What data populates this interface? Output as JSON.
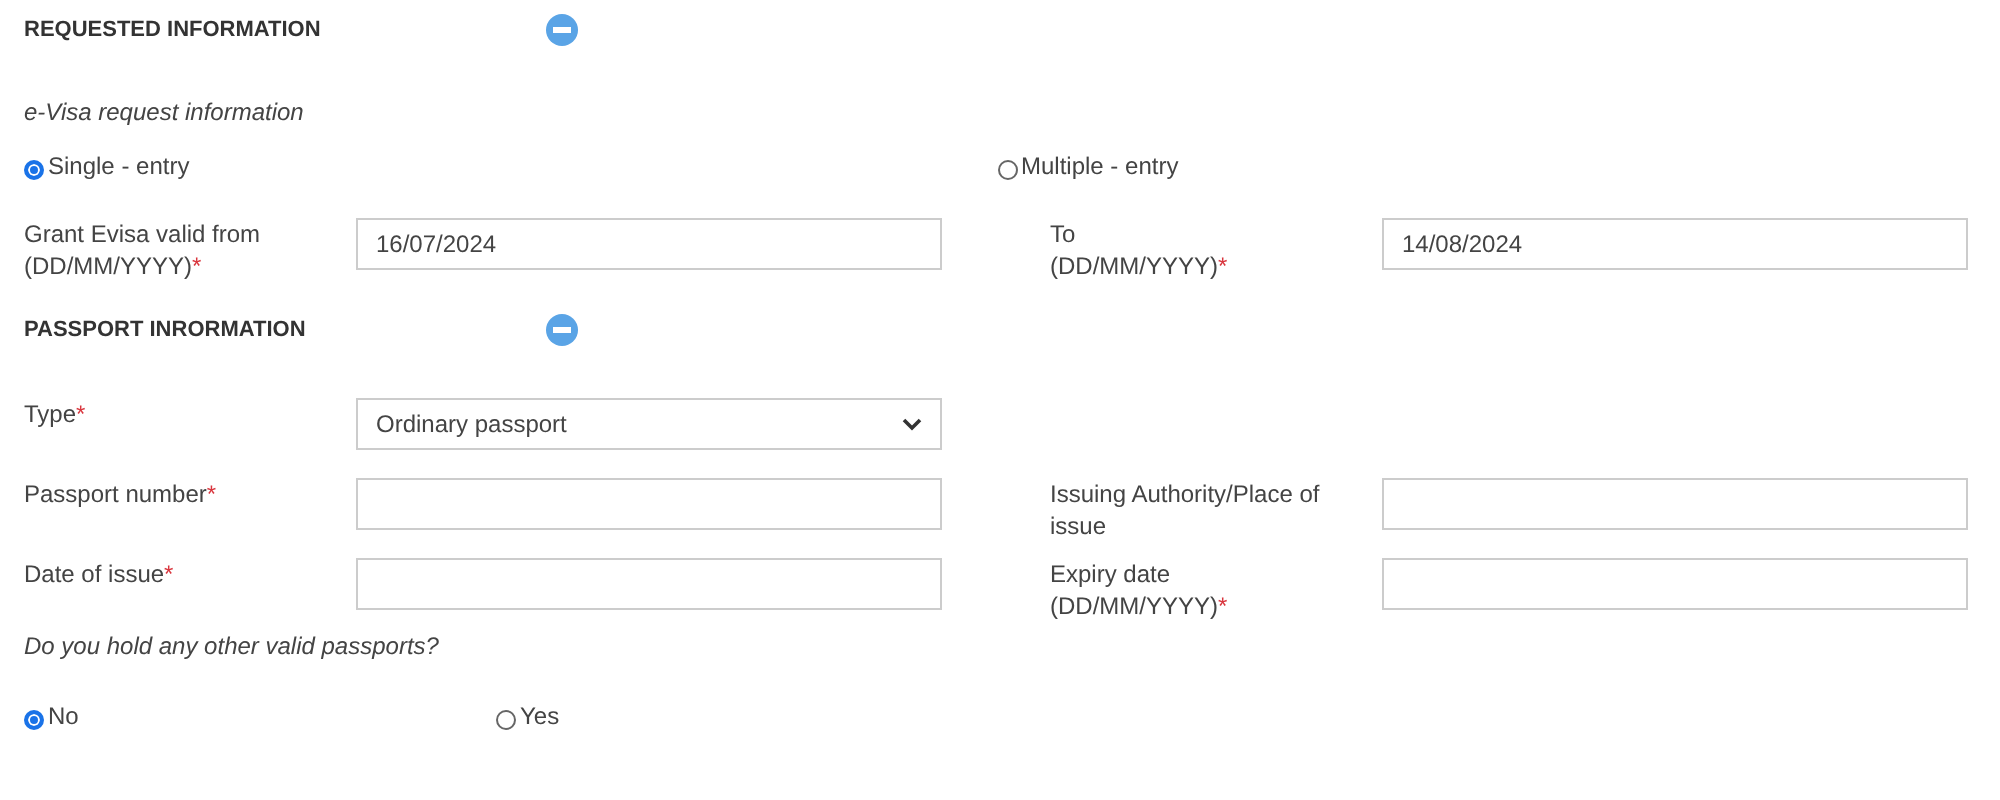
{
  "sections": [
    {
      "heading": "REQUESTED INFORMATION",
      "expanded": true,
      "blocks": [
        {
          "kind": "note",
          "text": "e-Visa request information"
        },
        {
          "kind": "radios",
          "options": [
            {
              "label": "Single - entry",
              "selected": true
            },
            {
              "label": "Multiple - entry",
              "selected": false
            }
          ]
        },
        {
          "kind": "row",
          "fields": [
            {
              "kind": "text",
              "label": "Grant Evisa valid from\n(DD/MM/YYYY)",
              "required_mark": "*",
              "value": "16/07/2024"
            },
            {
              "kind": "text",
              "label": "To\n(DD/MM/YYYY)",
              "required_mark": "*",
              "value": "14/08/2024"
            }
          ]
        }
      ]
    },
    {
      "heading": "PASSPORT INRORMATION",
      "expanded": true,
      "blocks": [
        {
          "kind": "row",
          "fields": [
            {
              "kind": "select",
              "label": "Type",
              "required_mark": "*",
              "value": "Ordinary passport"
            }
          ]
        },
        {
          "kind": "row",
          "fields": [
            {
              "kind": "text",
              "label": "Passport number",
              "required_mark": "*"
            },
            {
              "kind": "text",
              "label": "Issuing Authority/Place of issue"
            }
          ]
        },
        {
          "kind": "row",
          "fields": [
            {
              "kind": "text",
              "label": "Date of issue",
              "required_mark": "*"
            },
            {
              "kind": "text",
              "label": "Expiry date\n(DD/MM/YYYY)",
              "required_mark": "*"
            }
          ]
        },
        {
          "kind": "note",
          "text": "Do you hold any other valid passports?"
        },
        {
          "kind": "radios",
          "narrow": true,
          "options": [
            {
              "label": "No",
              "selected": true
            },
            {
              "label": "Yes",
              "selected": false
            }
          ]
        }
      ]
    }
  ]
}
